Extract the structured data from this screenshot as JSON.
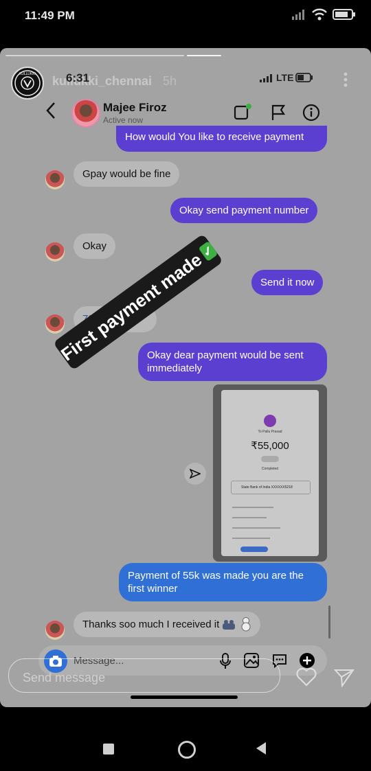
{
  "status_bar": {
    "time": "11:49 PM",
    "battery": "battery-icon",
    "wifi": "wifi-icon",
    "signal": "signal-icon"
  },
  "story": {
    "username": "kullukki_chennai",
    "age": "5h",
    "logo_text": "KULLUKKI",
    "reply_placeholder": "Send message",
    "sticker_text": "First payment made"
  },
  "inner": {
    "time": "6:31",
    "network": "LTE"
  },
  "chat": {
    "contact_name": "Majee Firoz",
    "status": "Active now",
    "messages": [
      {
        "side": "out",
        "text": "How would You like to receive payment"
      },
      {
        "side": "in",
        "text": "Gpay would be fine"
      },
      {
        "side": "out",
        "text": "Okay send payment number"
      },
      {
        "side": "in",
        "text": "Okay"
      },
      {
        "side": "out",
        "text": "Send it now"
      },
      {
        "side": "in",
        "text": "735"
      },
      {
        "side": "in",
        "text": "56"
      },
      {
        "side": "out",
        "text": "Okay dear payment would be sent immediately"
      },
      {
        "side": "out",
        "text": "Payment of 55k was made you are the first winner"
      },
      {
        "side": "in",
        "text": "Thanks soo much I received it"
      }
    ],
    "composer_placeholder": "Message..."
  },
  "payment_screenshot": {
    "amount": "₹55,000",
    "to_label": "To Pallu Prasad",
    "bank": "State Bank of India XXXXXX5218",
    "status": "Completed"
  },
  "colors": {
    "outgoing_bubble": "#5b3fd0",
    "outgoing_bubble_alt": "#2f6fd6",
    "incoming_bubble": "#b8b8b8",
    "story_overlay": "#a3a3a3"
  }
}
